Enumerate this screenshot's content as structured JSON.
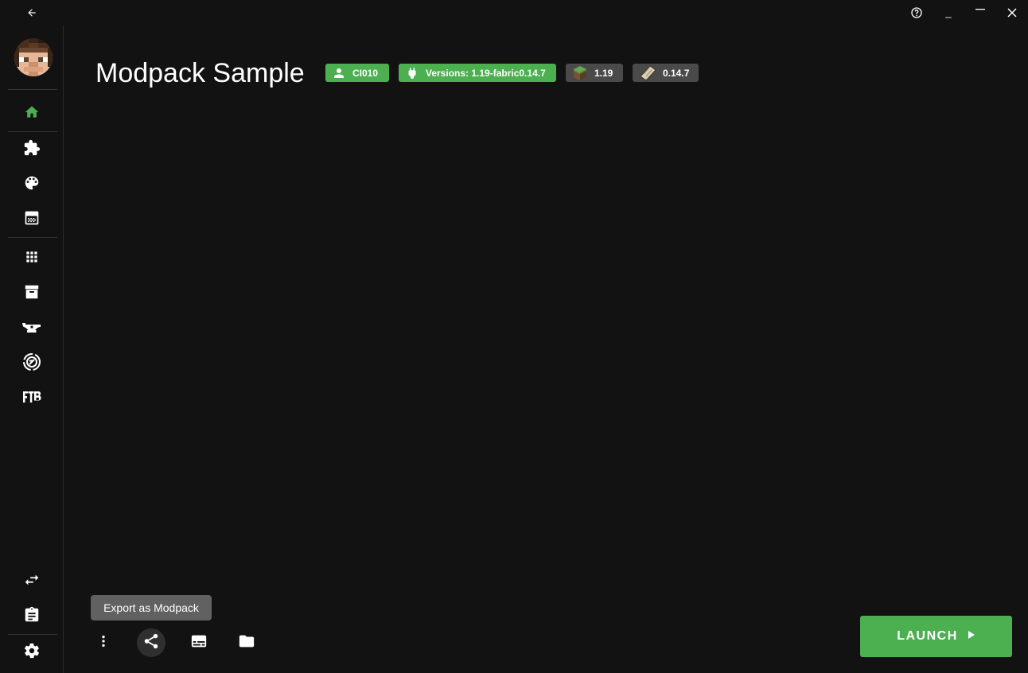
{
  "window": {
    "back_icon": "arrow-left-icon",
    "help_icon": "help-circle-icon",
    "minimize_label": "_",
    "maximize_icon": "maximize-icon",
    "close_icon": "close-icon"
  },
  "sidebar": {
    "avatar_icon": "player-skin-avatar",
    "accent_color": "#4caf50",
    "items": [
      {
        "name": "home",
        "icon": "home-icon",
        "active": true
      },
      {
        "name": "mods",
        "icon": "puzzle-icon",
        "active": false
      },
      {
        "name": "resourcepacks",
        "icon": "palette-icon",
        "active": false
      },
      {
        "name": "saves",
        "icon": "texture-icon",
        "active": false
      },
      {
        "name": "library",
        "icon": "grid-icon",
        "active": false
      },
      {
        "name": "archive",
        "icon": "archive-icon",
        "active": false
      },
      {
        "name": "forge",
        "icon": "anvil-icon",
        "active": false
      },
      {
        "name": "curseforge",
        "icon": "curseforge-icon",
        "active": false
      },
      {
        "name": "ftb",
        "icon": "ftb-icon",
        "active": false
      },
      {
        "name": "sync",
        "icon": "swap-icon",
        "active": false
      },
      {
        "name": "tasks",
        "icon": "clipboard-icon",
        "active": false
      },
      {
        "name": "settings",
        "icon": "gear-icon",
        "active": false
      }
    ]
  },
  "instance": {
    "title": "Modpack Sample",
    "chips": [
      {
        "label": "CI010",
        "icon": "person-icon",
        "color": "#4caf50"
      },
      {
        "label": "Versions: 1.19-fabric0.14.7",
        "icon": "plug-icon",
        "color": "#4caf50"
      },
      {
        "label": "1.19",
        "icon": "grass-block-icon",
        "color": "#4a4a4a"
      },
      {
        "label": "0.14.7",
        "icon": "fabric-icon",
        "color": "#4a4a4a"
      }
    ]
  },
  "bottom": {
    "tooltip": "Export as Modpack",
    "buttons": [
      {
        "name": "more",
        "icon": "dots-vertical-icon"
      },
      {
        "name": "share",
        "icon": "share-icon"
      },
      {
        "name": "logs",
        "icon": "subtitles-icon"
      },
      {
        "name": "folder",
        "icon": "folder-icon"
      }
    ],
    "launch_label": "LAUNCH",
    "launch_color": "#4caf50"
  }
}
